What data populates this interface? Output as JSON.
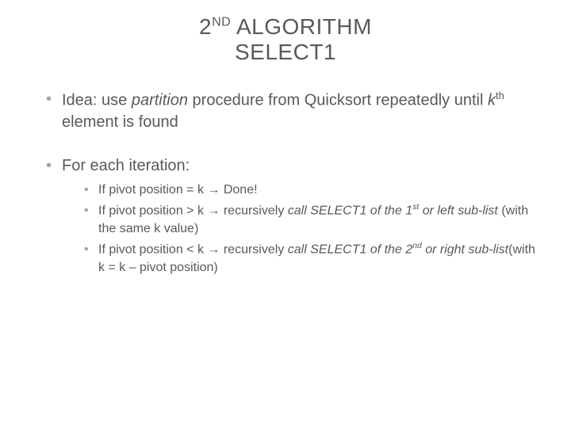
{
  "title": {
    "prefix": "2",
    "ordinal": "ND",
    "word1": " ALGORITHM",
    "line2": "SELECT1"
  },
  "bullets": {
    "b1_pre": "Idea: use ",
    "b1_ital": "partition",
    "b1_mid": " procedure from Quicksort repeatedly until ",
    "b1_k": "k",
    "b1_th": "th",
    "b1_post": " element is found",
    "b2": "For each iteration:",
    "sub1_pre": "If pivot position = k  ",
    "sub1_arrow": "→",
    "sub1_post": "  Done!",
    "sub2_pre": "If pivot position > k  ",
    "sub2_arrow": "→",
    "sub2_mid": "  recursively ",
    "sub2_ital_a": "call SELECT1 of the 1",
    "sub2_st": "st",
    "sub2_ital_b": " or left sub-list",
    "sub2_paren": " (with the same k value)",
    "sub3_pre": "If pivot position < k  ",
    "sub3_arrow": "→",
    "sub3_mid": "  recursively ",
    "sub3_ital_a": "call SELECT1 of the 2",
    "sub3_nd": "nd",
    "sub3_ital_b": " or right sub-list",
    "sub3_paren": "(with k = k – pivot position)"
  }
}
